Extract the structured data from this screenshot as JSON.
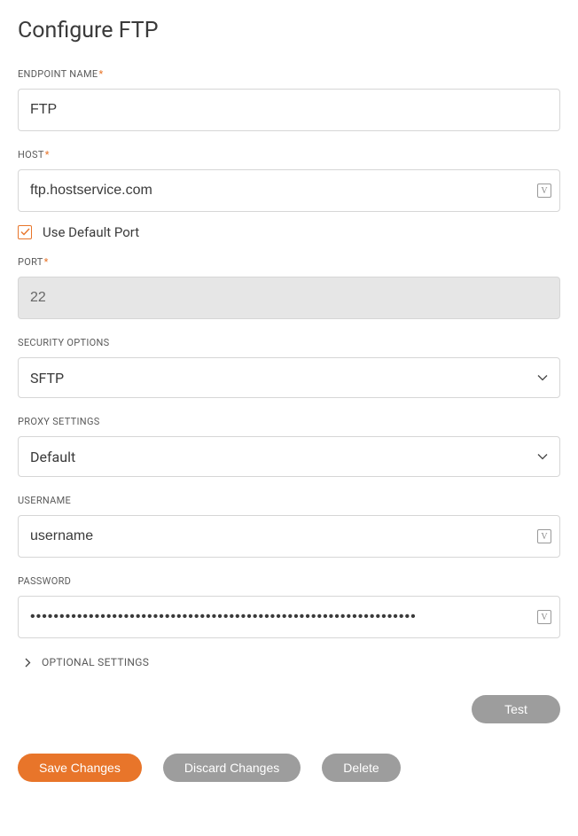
{
  "page": {
    "title": "Configure FTP"
  },
  "labels": {
    "endpointName": "ENDPOINT NAME",
    "host": "HOST",
    "useDefaultPort": "Use Default Port",
    "port": "PORT",
    "securityOptions": "SECURITY OPTIONS",
    "proxySettings": "PROXY SETTINGS",
    "username": "USERNAME",
    "password": "PASSWORD",
    "optionalSettings": "OPTIONAL SETTINGS",
    "requiredMark": "*"
  },
  "values": {
    "endpointName": "FTP",
    "host": "ftp.hostservice.com",
    "useDefaultPort": true,
    "port": "22",
    "securityOptions": "SFTP",
    "proxySettings": "Default",
    "username": "username",
    "password": "••••••••••••••••••••••••••••••••••••••••••••••••••••••••••••••••••"
  },
  "buttons": {
    "test": "Test",
    "save": "Save Changes",
    "discard": "Discard Changes",
    "delete": "Delete"
  },
  "icons": {
    "variableGlyph": "V"
  }
}
